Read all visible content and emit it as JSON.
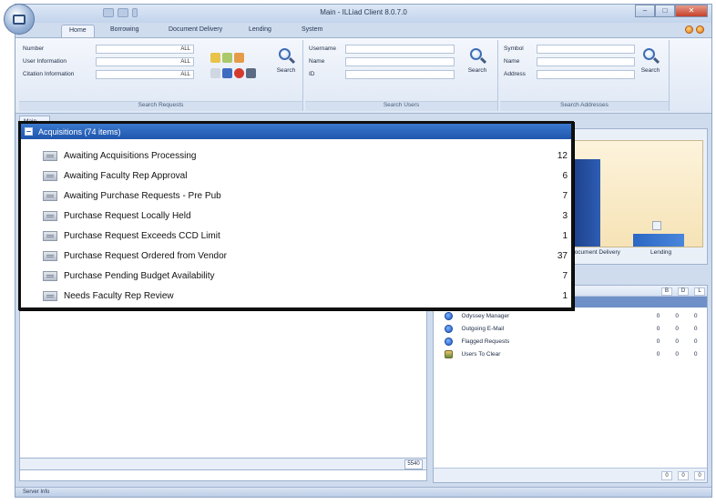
{
  "window": {
    "title": "Main - ILLiad Client 8.0.7.0"
  },
  "ribbon_tabs": [
    "Home",
    "Borrowing",
    "Document Delivery",
    "Lending",
    "System"
  ],
  "search_requests": {
    "fields": [
      {
        "label": "Number",
        "value": "ALL"
      },
      {
        "label": "User Information",
        "value": "ALL"
      },
      {
        "label": "Citation Information",
        "value": "ALL"
      }
    ],
    "button": "Search",
    "group_label": "Search Requests"
  },
  "search_users": {
    "fields": [
      {
        "label": "Username"
      },
      {
        "label": "Name"
      },
      {
        "label": "ID"
      }
    ],
    "button": "Search",
    "group_label": "Search Users"
  },
  "search_addresses": {
    "fields": [
      {
        "label": "Symbol"
      },
      {
        "label": "Name"
      },
      {
        "label": "Address"
      }
    ],
    "button": "Search",
    "group_label": "Search Addresses"
  },
  "doc_tab": "Main",
  "chart": {
    "labels": [
      "Document Delivery",
      "Lending"
    ]
  },
  "acquisitions": {
    "header": "Acquisitions (74 items)",
    "items": [
      {
        "label": "Awaiting Acquisitions Processing",
        "count": "12"
      },
      {
        "label": "Awaiting Faculty Rep Approval",
        "count": "6"
      },
      {
        "label": "Awaiting Purchase Requests - Pre Pub",
        "count": "7"
      },
      {
        "label": "Purchase Request Locally Held",
        "count": "3"
      },
      {
        "label": "Purchase Request Exceeds CCD Limit",
        "count": "1"
      },
      {
        "label": "Purchase Request Ordered from Vendor",
        "count": "37"
      },
      {
        "label": "Purchase Pending Budget Availability",
        "count": "7"
      },
      {
        "label": "Needs Faculty Rep Review",
        "count": "1"
      }
    ]
  },
  "right_panel": {
    "columns": [
      "B",
      "D",
      "L"
    ],
    "rows": [
      {
        "label": "Odyssey Manager",
        "b": "0",
        "d": "0",
        "l": "0"
      },
      {
        "label": "Outgoing E-Mail",
        "b": "0",
        "d": "0",
        "l": "0"
      },
      {
        "label": "Flagged Requests",
        "b": "0",
        "d": "0",
        "l": "0"
      },
      {
        "label": "Users To Clear",
        "b": "0",
        "d": "0",
        "l": "0"
      }
    ],
    "footer": [
      "0",
      "0",
      "0"
    ]
  },
  "left_footer_count": "5540",
  "status_text": "Server Info",
  "colors": {
    "accent_blue": "#1f56ad",
    "frame": "#cfdcee"
  }
}
